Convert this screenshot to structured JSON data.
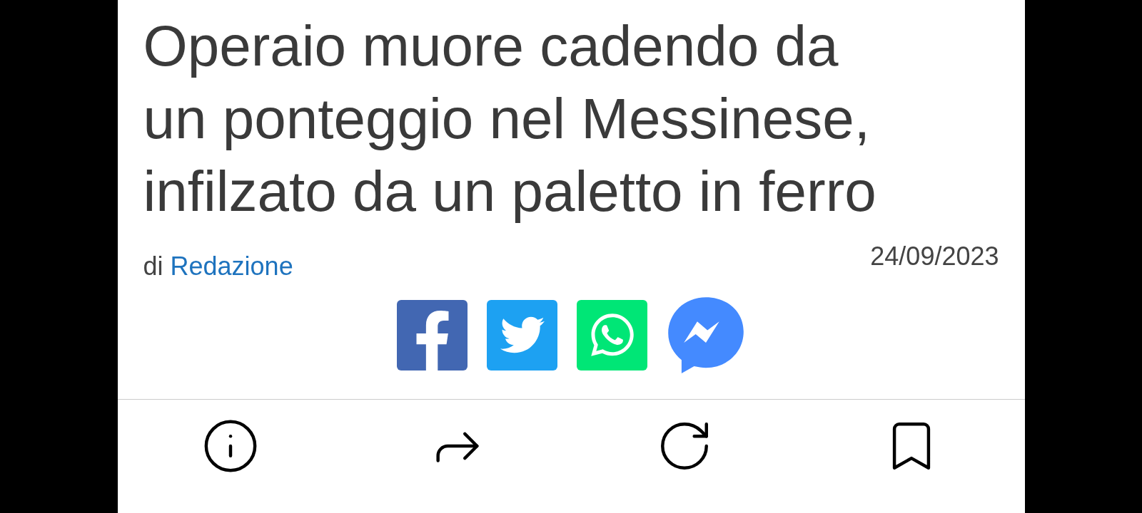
{
  "article": {
    "title_lines": [
      "Operaio muore cadendo da",
      "un ponteggio nel Messinese,",
      "infilzato da un paletto in ferro"
    ],
    "byline_prefix": "di",
    "author": "Redazione",
    "date": "24/09/2023"
  },
  "share_buttons": [
    {
      "kind": "facebook"
    },
    {
      "kind": "twitter"
    },
    {
      "kind": "whatsapp"
    },
    {
      "kind": "messenger"
    }
  ],
  "toolbar": [
    {
      "kind": "info"
    },
    {
      "kind": "share"
    },
    {
      "kind": "reload"
    },
    {
      "kind": "bookmark"
    }
  ]
}
